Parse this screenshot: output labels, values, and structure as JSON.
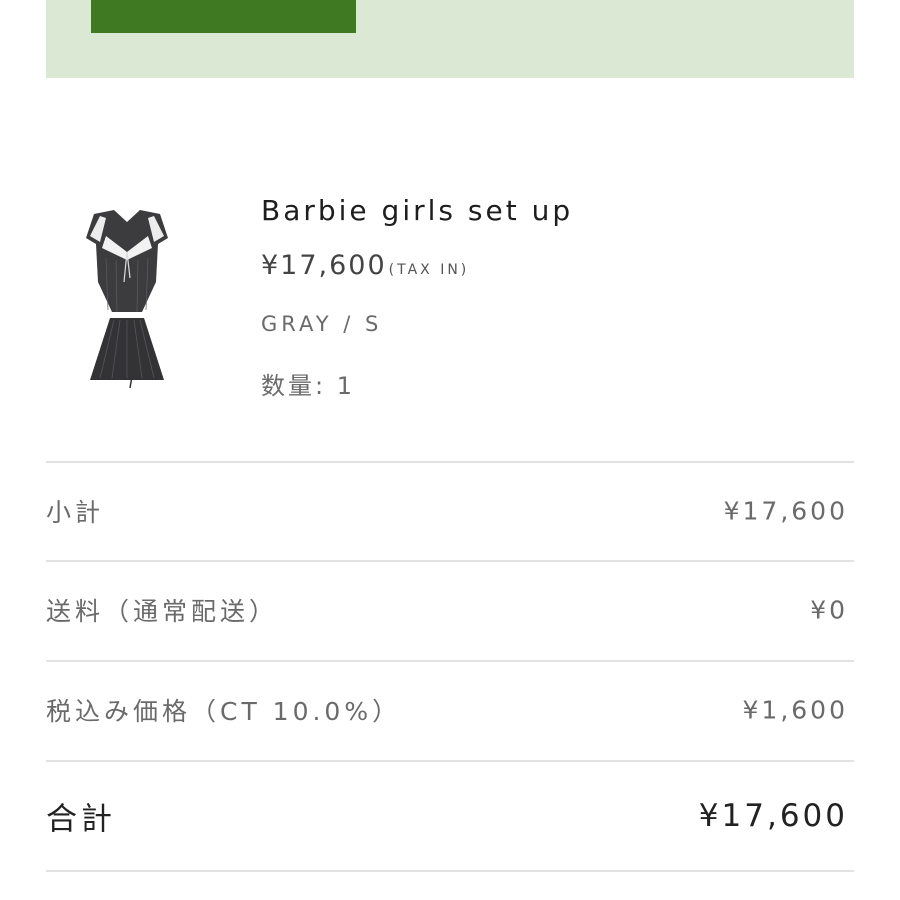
{
  "banner": {
    "button_color": "#3f7a22",
    "background": "#dbe8d3"
  },
  "product": {
    "image_icon": "product-outfit-image",
    "name": "Barbie girls set up",
    "price": "¥17,600",
    "tax_note": "(TAX IN)",
    "variant": "GRAY / S",
    "quantity": "数量: 1"
  },
  "summary": {
    "subtotal": {
      "label": "小計",
      "value": "¥17,600"
    },
    "shipping": {
      "label": "送料（通常配送）",
      "value": "¥0"
    },
    "tax": {
      "label": "税込み価格（CT 10.0%）",
      "value": "¥1,600"
    },
    "total": {
      "label": "合計",
      "value": "¥17,600"
    }
  }
}
